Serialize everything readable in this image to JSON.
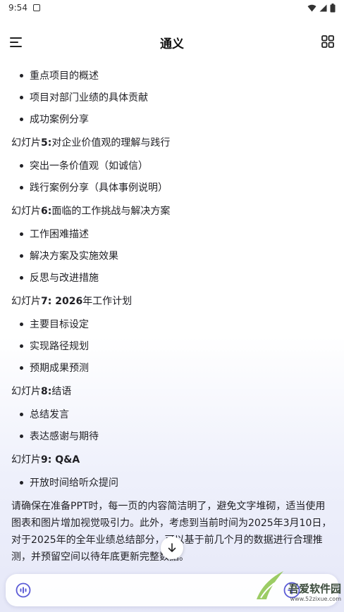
{
  "status_bar": {
    "time": "9:54"
  },
  "header": {
    "title": "通义"
  },
  "content": {
    "top_bullets": [
      "重点项目的概述",
      "项目对部门业绩的具体贡献",
      "成功案例分享"
    ],
    "slides": [
      {
        "prefix": "幻灯片",
        "num": "5:",
        "title": " 对企业价值观的理解与践行",
        "bullets": [
          "突出一条价值观（如诚信）",
          "践行案例分享（具体事例说明）"
        ]
      },
      {
        "prefix": "幻灯片",
        "num": "6:",
        "title": " 面临的工作挑战与解决方案",
        "bullets": [
          "工作困难描述",
          "解决方案及实施效果",
          "反思与改进措施"
        ]
      },
      {
        "prefix": "幻灯片",
        "num": "7: 2026",
        "title": "年工作计划",
        "bullets": [
          "主要目标设定",
          "实现路径规划",
          "预期成果预测"
        ]
      },
      {
        "prefix": "幻灯片",
        "num": "8:",
        "title": " 结语",
        "bullets": [
          "总结发言",
          "表达感谢与期待"
        ]
      },
      {
        "prefix": "幻灯片",
        "num": "9: Q&A",
        "title": "",
        "bullets": [
          "开放时间给听众提问"
        ]
      }
    ],
    "paragraph": "请确保在准备PPT时，每一页的内容简洁明了，避免文字堆砌，适当使用图表和图片增加视觉吸引力。此外，考虑到当前时间为2025年3月10日，对于2025年的全年业绩总结部分，可以基于前几个月的数据进行合理推测，并预留空间以待年底更新完整数据。"
  },
  "watermark": {
    "name": "吾爱软件园",
    "url": "www.52zixue.com"
  },
  "icons": {
    "menu": "menu-icon",
    "grid": "grid-icon",
    "scroll_down": "arrow-down-icon",
    "voice": "voice-icon",
    "send": "send-icon",
    "wifi": "wifi-icon",
    "battery": "battery-icon"
  },
  "colors": {
    "accent": "#5b5bd6",
    "text": "#1f1f24"
  }
}
